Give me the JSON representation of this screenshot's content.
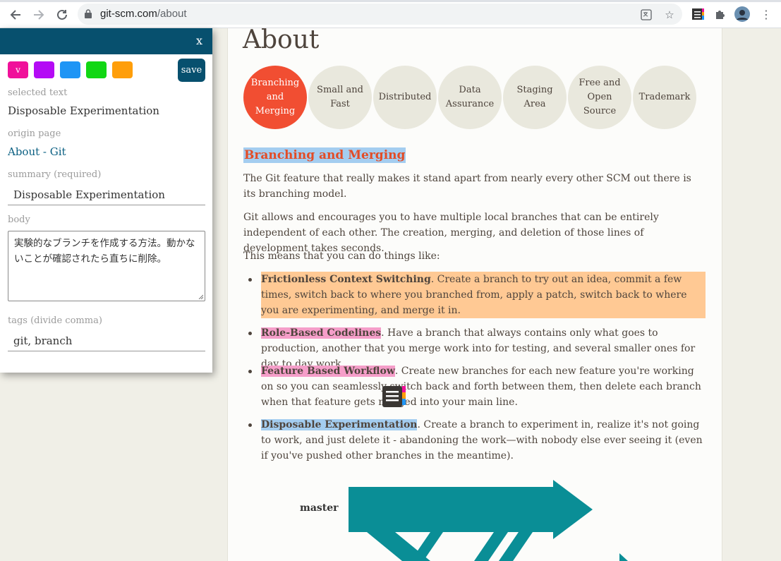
{
  "browser": {
    "url_domain": "git-scm.com",
    "url_path": "/about"
  },
  "page": {
    "title": "About",
    "circles": [
      {
        "label": "Branching and Merging",
        "active": true
      },
      {
        "label": "Small and Fast",
        "active": false
      },
      {
        "label": "Distributed",
        "active": false
      },
      {
        "label": "Data Assurance",
        "active": false
      },
      {
        "label": "Staging Area",
        "active": false
      },
      {
        "label": "Free and Open Source",
        "active": false
      },
      {
        "label": "Trademark",
        "active": false
      }
    ],
    "section_title": "Branching and Merging",
    "para1": "The Git feature that really makes it stand apart from nearly every other SCM out there is its branching model.",
    "para2": "Git allows and encourages you to have multiple local branches that can be entirely independent of each other. The creation, merging, and deletion of those lines of development takes seconds.",
    "para3": "This means that you can do things like:",
    "bullets": [
      {
        "title": "Frictionless Context Switching",
        "body": ". Create a branch to try out an idea, commit a few times, switch back to where you branched from, apply a patch, switch back to where you are experimenting, and merge it in."
      },
      {
        "title": "Role-Based Codelines",
        "body": ". Have a branch that always contains only what goes to production, another that you merge work into for testing, and several smaller ones for day to day work."
      },
      {
        "title": "Feature Based Workflow",
        "body": ". Create new branches for each new feature you're working on so you can seamlessly switch back and forth between them, then delete each branch when that feature gets merged into your main line."
      },
      {
        "title": "Disposable Experimentation",
        "body": ". Create a branch to experiment in, realize it's not going to work, and just delete it - abandoning the work—with nobody else ever seeing it (even if you've pushed other branches in the meantime)."
      }
    ],
    "diagram_label": "master"
  },
  "panel": {
    "close": "x",
    "swatch_selected": "v",
    "save": "save",
    "selected_text_label": "selected text",
    "selected_text": "Disposable Experimentation",
    "origin_label": "origin page",
    "origin": "About - Git",
    "summary_label": "summary (required)",
    "summary": "Disposable Experimentation",
    "body_label": "body",
    "body": "実験的なブランチを作成する方法。動かないことが確認されたら直ちに削除。",
    "tags_label": "tags (divide comma)",
    "tags": "git, branch"
  },
  "colors": {
    "panel_header": "#07506e",
    "swatches": [
      "#f0119a",
      "#b40bf5",
      "#1f95f5",
      "#11d714",
      "#ff9e0a"
    ],
    "active_circle": "#f14e32",
    "highlight_orange": "#ffc994",
    "highlight_pink": "#f59ec9",
    "highlight_blue": "#a4cdf0"
  }
}
